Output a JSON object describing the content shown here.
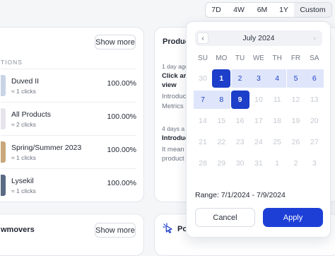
{
  "range_selector": {
    "options": [
      "7D",
      "4W",
      "6M",
      "1Y",
      "Custom"
    ],
    "active": "Custom"
  },
  "top_cards": {
    "show_more_label": "Show more",
    "section_label": "TIONS",
    "rows": [
      {
        "title": "Duved II",
        "sub": "≈ 1 clicks",
        "pct": "100.00%",
        "thumb_color": "#c9d4e6"
      },
      {
        "title": "All Products",
        "sub": "≈ 2 clicks",
        "pct": "100.00%",
        "thumb_color": "#e7e3ea"
      },
      {
        "title": "Spring/Summer 2023",
        "sub": "≈ 1 clicks",
        "pct": "100.00%",
        "thumb_color": "#c9a77a"
      },
      {
        "title": "Lysekil",
        "sub": "≈ 1 clicks",
        "pct": "100.00%",
        "thumb_color": "#5a6b85"
      }
    ]
  },
  "activity_card": {
    "title": "Produc",
    "items": [
      {
        "time": "1 day ago",
        "line1": "Click ar",
        "line2": "view",
        "desc1": "Introduc",
        "desc2": "Metrics"
      },
      {
        "time": "4 days a",
        "line1": "Introduc",
        "desc1": "It mean",
        "desc2": "product"
      }
    ]
  },
  "bottom_cards": {
    "left_title": "wmovers",
    "show_more_label": "Show more",
    "right_title": "Po"
  },
  "calendar": {
    "month_label": "July 2024",
    "prev_icon": "chevron-left-icon",
    "next_icon": "chevron-right-icon",
    "weekdays": [
      "SU",
      "MO",
      "TU",
      "WE",
      "TH",
      "FR",
      "SA"
    ],
    "weeks": [
      [
        "30",
        "1",
        "2",
        "3",
        "4",
        "5",
        "6"
      ],
      [
        "7",
        "8",
        "9",
        "10",
        "11",
        "12",
        "13"
      ],
      [
        "14",
        "15",
        "16",
        "17",
        "18",
        "19",
        "20"
      ],
      [
        "21",
        "22",
        "23",
        "24",
        "25",
        "26",
        "27"
      ],
      [
        "28",
        "29",
        "30",
        "31",
        "1",
        "2",
        "3"
      ]
    ],
    "range_text": "Range: 7/1/2024 - 7/9/2024",
    "cancel_label": "Cancel",
    "apply_label": "Apply",
    "accent_color": "#1d3fc9"
  }
}
